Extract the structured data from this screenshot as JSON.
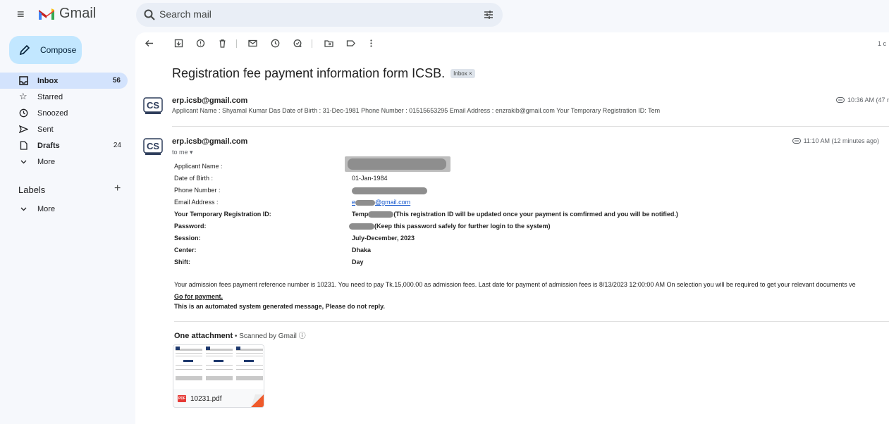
{
  "app": {
    "name": "Gmail"
  },
  "search": {
    "placeholder": "Search mail"
  },
  "compose": {
    "label": "Compose"
  },
  "nav": [
    {
      "label": "Inbox",
      "count": "56",
      "icon": "inbox-icon",
      "active": true
    },
    {
      "label": "Starred",
      "count": "",
      "icon": "star-icon"
    },
    {
      "label": "Snoozed",
      "count": "",
      "icon": "clock-icon"
    },
    {
      "label": "Sent",
      "count": "",
      "icon": "send-icon"
    },
    {
      "label": "Drafts",
      "count": "24",
      "icon": "draft-icon"
    },
    {
      "label": "More",
      "count": "",
      "icon": "chevron-down-icon"
    }
  ],
  "labels": {
    "heading": "Labels",
    "more": "More"
  },
  "toolbar": {
    "page_count": "1 c"
  },
  "email": {
    "subject": "Registration fee payment information form ICSB.",
    "chip": "Inbox ×",
    "message1": {
      "sender": "erp.icsb@gmail.com",
      "snippet": "Applicant Name : Shyamal Kumar Das Date of Birth : 31-Dec-1981 Phone Number : 01515653295 Email Address : enzrakib@gmail.com Your Temporary Registration ID: Tem",
      "time": "10:36 AM (47 r"
    },
    "message2": {
      "sender": "erp.icsb@gmail.com",
      "to": "to me ▾",
      "time": "11:10 AM (12 minutes ago)",
      "fields": {
        "applicant_name_label": "Applicant Name :",
        "dob_label": "Date of Birth :",
        "dob_value": "01-Jan-1984",
        "phone_label": "Phone Number :",
        "email_label": "Email Address :",
        "email_prefix": "e",
        "email_suffix": "@gmail.com",
        "reg_label": "Your Temporary Registration ID:",
        "reg_prefix": "Temp",
        "reg_note": "(This registration ID will be updated once your payment is comfirmed and you will be notified.)",
        "password_label": "Password:",
        "password_note": "(Keep this password safely for further login to the system)",
        "session_label": "Session:",
        "session_value": "July-December, 2023",
        "center_label": "Center:",
        "center_value": "Dhaka",
        "shift_label": "Shift:",
        "shift_value": "Day"
      },
      "payment_text": "Your admission fees payment reference number is 10231. You need to pay Tk.15,000.00 as admission fees. Last date for payment of admission fees is 8/13/2023 12:00:00 AM On selection you will be required to get your relevant documents ve",
      "payment_link": "Go for payment.",
      "auto_note": "This is an automated system generated message, Please do not reply.",
      "attachment_heading": "One attachment",
      "scanned": " • Scanned by Gmail ⓘ",
      "attachment_name": "10231.pdf"
    }
  },
  "colors": {
    "accent": "#c2e7ff",
    "active_nav": "#d3e3fd",
    "link": "#1155cc",
    "background": "#f6f8fc"
  }
}
